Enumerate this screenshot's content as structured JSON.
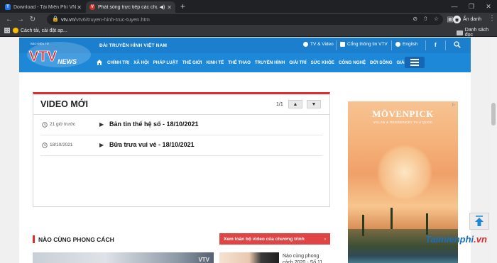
{
  "browser": {
    "tabs": [
      {
        "title": "Download - Tải Miễn Phí VN - Ph",
        "favicon": "T",
        "active": false
      },
      {
        "title": "Phát sóng trực tiếp các chươ",
        "favicon": "V",
        "active": true
      }
    ],
    "url_host": "vtv.vn",
    "url_path": "/vtv6/truyen-hinh-truc-tuyen.htm",
    "profile_label": "Ẩn danh",
    "bookmarks": [
      {
        "label": "Ứng dụng"
      },
      {
        "label": "Cách tải, cài đặt ap..."
      },
      {
        "label": "Danh sách đọc"
      }
    ]
  },
  "site": {
    "sitename": "ĐÀI TRUYỀN HÌNH VIỆT NAM",
    "logo_text": "VTV",
    "logo_sub": "NEWS",
    "top_links": [
      "TV & Video",
      "Cổng thông tin VTV",
      "English"
    ],
    "facebook_label": "f",
    "nav_items": [
      "CHÍNH TRỊ",
      "XÃ HỘI",
      "PHÁP LUẬT",
      "THẾ GIỚI",
      "KINH TẾ",
      "THỂ THAO",
      "TRUYỀN HÌNH",
      "GIẢI TRÍ",
      "SỨC KHỎE",
      "CÔNG NGHỆ",
      "ĐỜI SỐNG",
      "GIÁO DỤC"
    ]
  },
  "video_box": {
    "title": "VIDEO MỚI",
    "page_indicator": "1/1",
    "items": [
      {
        "time": "21 giờ trước",
        "title": "Bản tin thế hệ số - 18/10/2021"
      },
      {
        "time": "18/10/2021",
        "title": "Bữa trưa vui vẻ - 18/10/2021"
      }
    ]
  },
  "related": {
    "title": "NÀO CÙNG PHONG CÁCH",
    "view_all": "Xem toàn bộ video của chương trình",
    "view_all_arrow": "›",
    "thumb_label": "VTV",
    "item_title": "Nào cùng phong cách 2020 - Số 11"
  },
  "ad": {
    "brand": "MÖVENPICK",
    "subtitle": "VILLAS & RESIDENCES PHU QUOC"
  },
  "watermark": {
    "text_a": "Taimienphi",
    "text_b": ".vn"
  }
}
